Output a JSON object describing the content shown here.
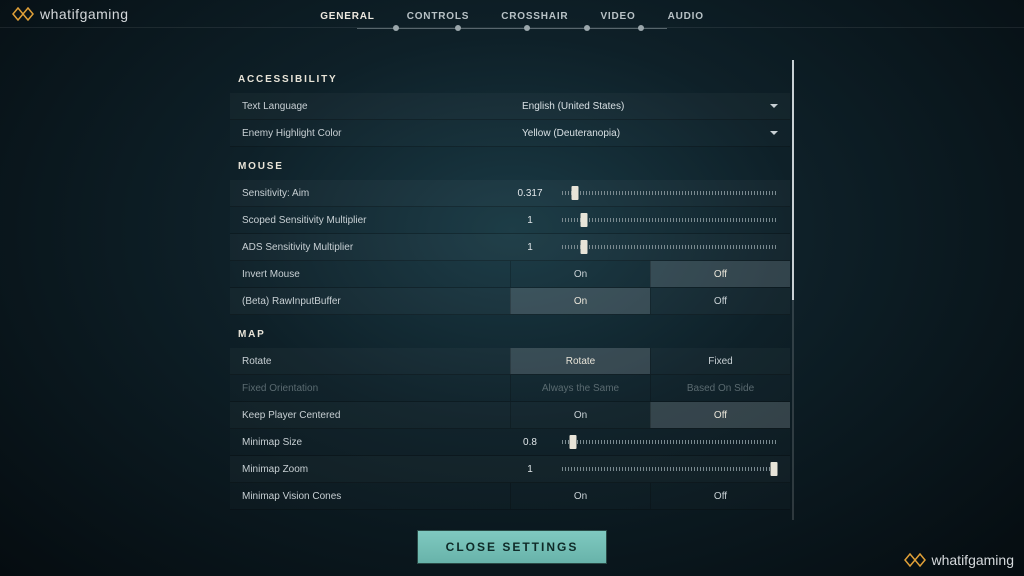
{
  "brand": "whatifgaming",
  "tabs": [
    "GENERAL",
    "CONTROLS",
    "CROSSHAIR",
    "VIDEO",
    "AUDIO"
  ],
  "active_tab": 0,
  "sections": {
    "accessibility": {
      "title": "ACCESSIBILITY",
      "rows": [
        {
          "label": "Text Language",
          "type": "dropdown",
          "value": "English (United States)"
        },
        {
          "label": "Enemy Highlight Color",
          "type": "dropdown",
          "value": "Yellow (Deuteranopia)"
        }
      ]
    },
    "mouse": {
      "title": "MOUSE",
      "rows": [
        {
          "label": "Sensitivity: Aim",
          "type": "slider",
          "value": "0.317",
          "pct": 6
        },
        {
          "label": "Scoped Sensitivity Multiplier",
          "type": "slider",
          "value": "1",
          "pct": 10
        },
        {
          "label": "ADS Sensitivity Multiplier",
          "type": "slider",
          "value": "1",
          "pct": 10
        },
        {
          "label": "Invert Mouse",
          "type": "toggle",
          "options": [
            "On",
            "Off"
          ],
          "selected": 1
        },
        {
          "label": "(Beta) RawInputBuffer",
          "type": "toggle",
          "options": [
            "On",
            "Off"
          ],
          "selected": 0
        }
      ]
    },
    "map": {
      "title": "MAP",
      "rows": [
        {
          "label": "Rotate",
          "type": "toggle",
          "options": [
            "Rotate",
            "Fixed"
          ],
          "selected": 0
        },
        {
          "label": "Fixed Orientation",
          "type": "toggle",
          "options": [
            "Always the Same",
            "Based On Side"
          ],
          "disabled": true
        },
        {
          "label": "Keep Player Centered",
          "type": "toggle",
          "options": [
            "On",
            "Off"
          ],
          "selected": 1
        },
        {
          "label": "Minimap Size",
          "type": "slider",
          "value": "0.8",
          "pct": 5
        },
        {
          "label": "Minimap Zoom",
          "type": "slider",
          "value": "1",
          "pct": 98
        },
        {
          "label": "Minimap Vision Cones",
          "type": "toggle",
          "options": [
            "On",
            "Off"
          ],
          "selected": 0,
          "noneSelected": true
        }
      ]
    }
  },
  "close_label": "CLOSE SETTINGS"
}
